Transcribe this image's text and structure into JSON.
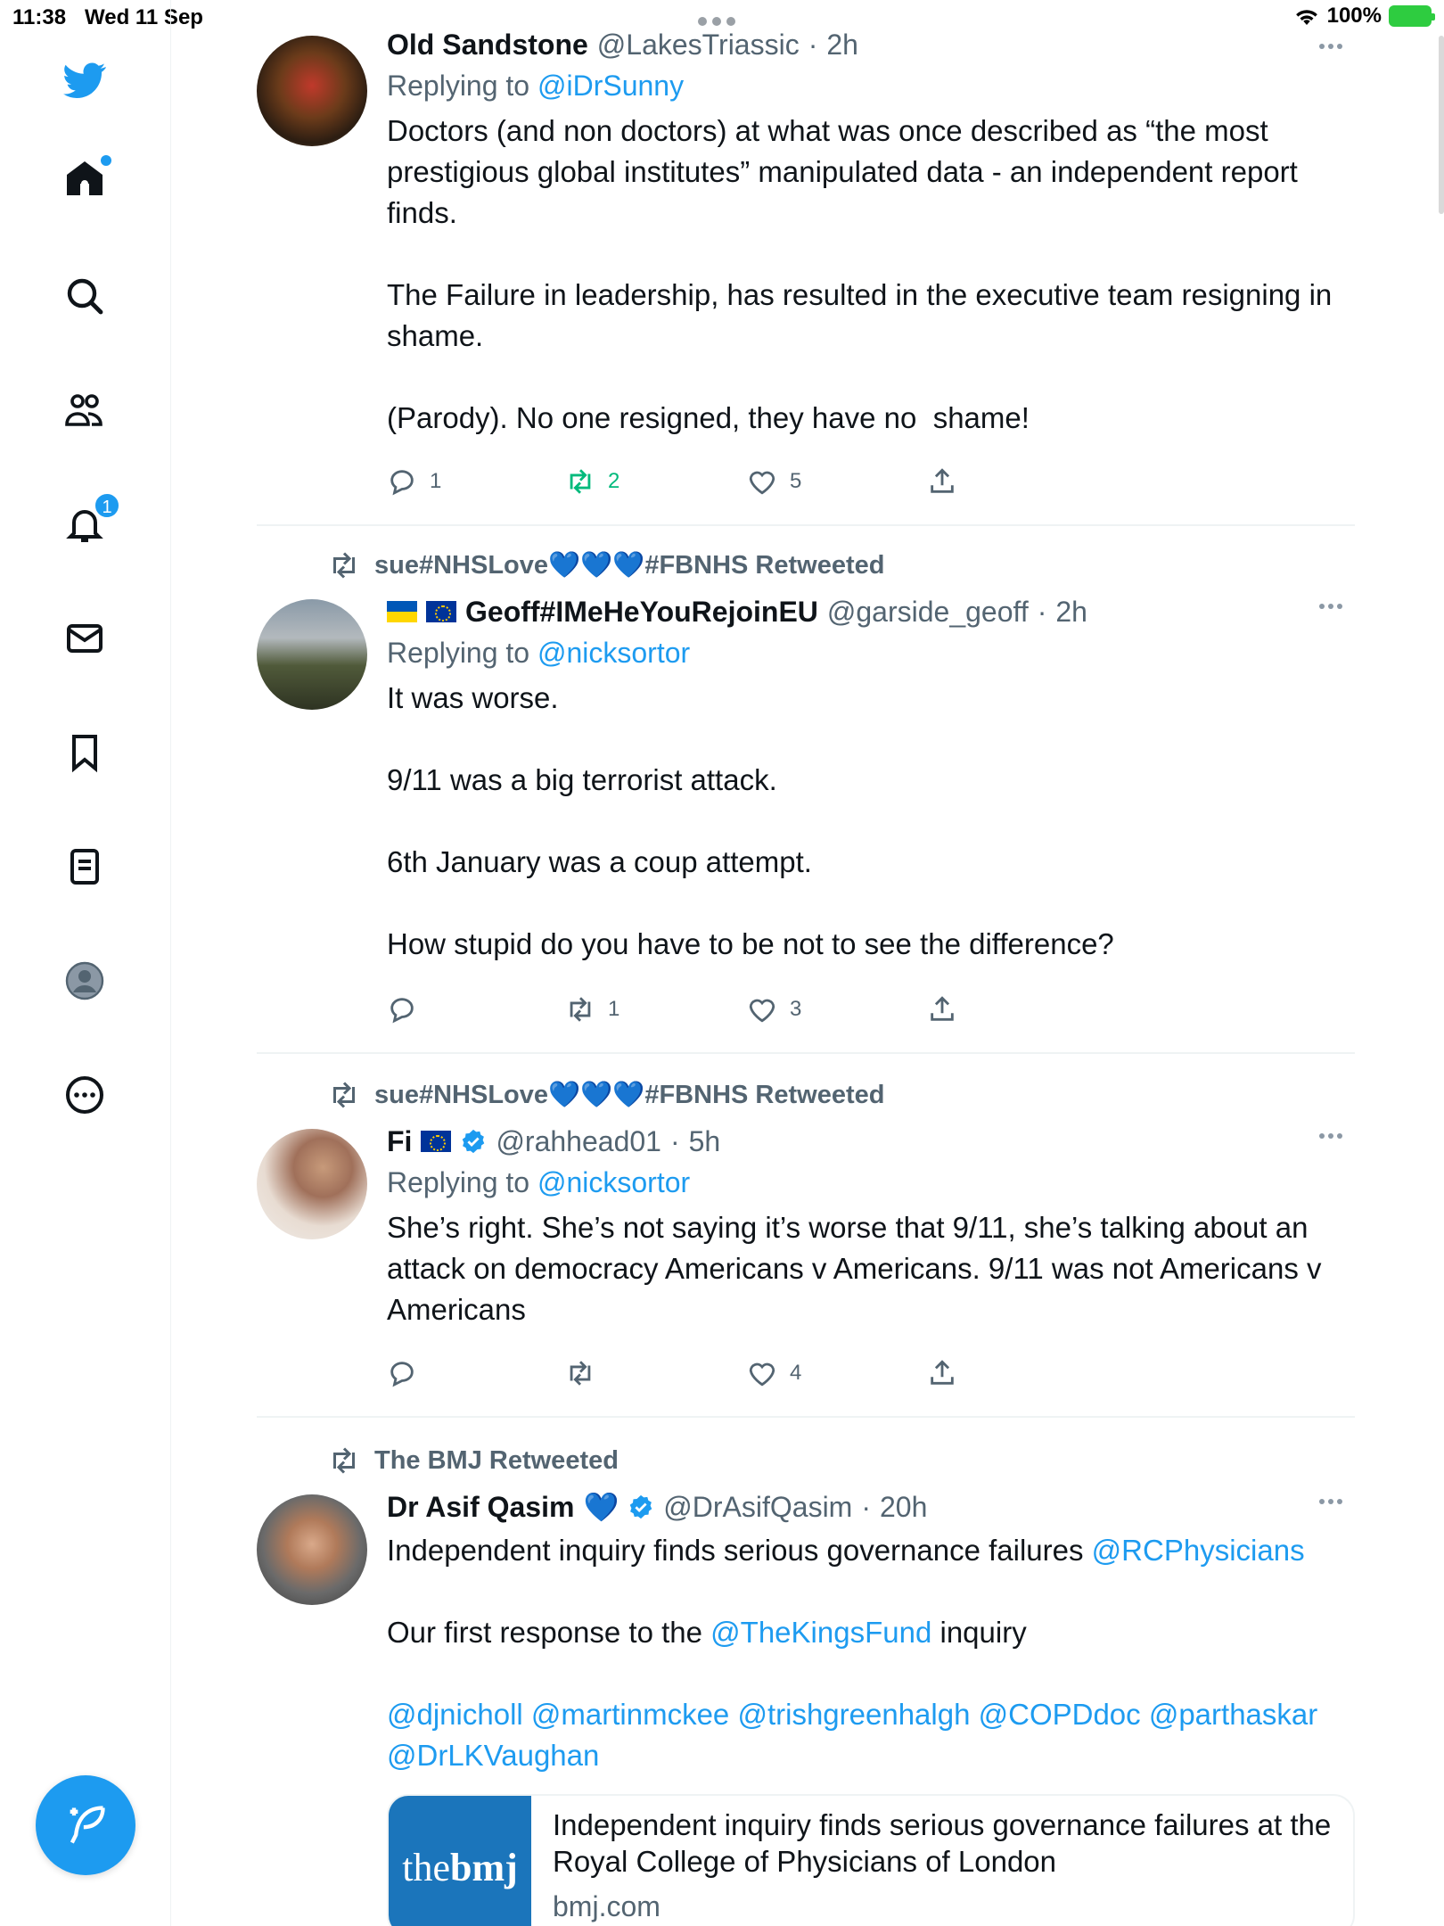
{
  "status_bar": {
    "time": "11:38",
    "date": "Wed 11 Sep",
    "battery": "100%"
  },
  "sidebar": {
    "notifications_badge": "1",
    "items": [
      {
        "name": "home"
      },
      {
        "name": "explore"
      },
      {
        "name": "communities"
      },
      {
        "name": "notifications"
      },
      {
        "name": "messages"
      },
      {
        "name": "bookmarks"
      },
      {
        "name": "lists"
      },
      {
        "name": "profile"
      },
      {
        "name": "more"
      }
    ]
  },
  "tweets": [
    {
      "name": "Old Sandstone",
      "handle": "@LakesTriassic",
      "time": "2h",
      "replying_label": "Replying to",
      "replying_to": "@iDrSunny",
      "text": "Doctors (and non doctors) at what was once described as “the most prestigious global institutes” manipulated data - an independent report finds.\n\nThe Failure in leadership, has resulted in the executive team resigning in shame.\n\n(Parody). No one resigned, they have no  shame!",
      "replies": "1",
      "retweets": "2",
      "likes": "5"
    },
    {
      "social": "sue#NHSLove💙💙💙#FBNHS Retweeted",
      "name": "Geoff#IMeHeYouRejoinEU",
      "handle": "@garside_geoff",
      "time": "2h",
      "replying_label": "Replying to",
      "replying_to": "@nicksortor",
      "text": "It was worse.\n\n9/11 was a big terrorist attack.\n\n6th January was a coup attempt.\n\nHow stupid do you have to be not to see the difference?",
      "replies": "",
      "retweets": "1",
      "likes": "3"
    },
    {
      "social": "sue#NHSLove💙💙💙#FBNHS Retweeted",
      "name": "Fi",
      "handle": "@rahhead01",
      "time": "5h",
      "replying_label": "Replying to",
      "replying_to": "@nicksortor",
      "text": "She’s right. She’s not saying it’s worse that 9/11, she’s talking about an attack on democracy Americans v Americans. 9/11 was not Americans v Americans",
      "replies": "",
      "retweets": "",
      "likes": "4"
    },
    {
      "social": "The BMJ Retweeted",
      "name": "Dr Asif Qasim",
      "name_emoji": "💙",
      "handle": "@DrAsifQasim",
      "time": "20h",
      "text_line1": "Independent inquiry finds serious governance failures ",
      "mention1": "@RCPhysicians",
      "text_line2": "Our first response to the ",
      "mention2": "@TheKingsFund",
      "text_line2_end": " inquiry",
      "mentions": "@djnicholl @martinmckee @trishgreenhalgh @COPDdoc @parthaskar @DrLKVaughan",
      "card": {
        "thumb_a": "the",
        "thumb_b": "bmj",
        "title": "Independent inquiry finds serious governance failures at the Royal College of Physicians of London",
        "domain": "bmj.com"
      }
    }
  ],
  "colors": {
    "accent": "#1d9bf0",
    "retweet_green": "#00ba7c",
    "text": "#0f1419",
    "muted": "#536471"
  }
}
